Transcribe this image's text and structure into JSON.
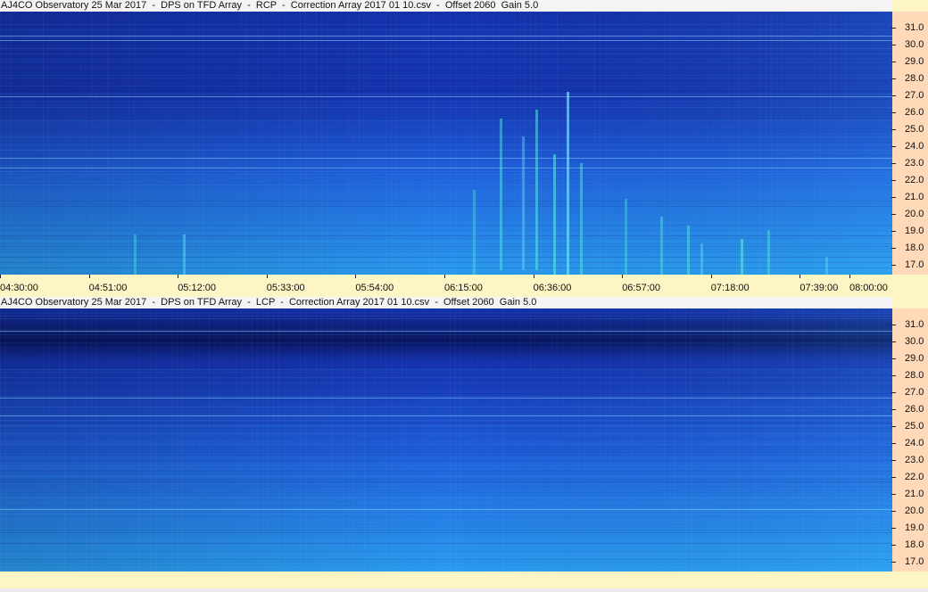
{
  "chart_data": [
    {
      "type": "heatmap",
      "title": "AJ4CO Observatory 25 Mar 2017  -  DPS on TFD Array  -  RCP  -  Correction Array 2017 01 10.csv  -  Offset 2060  Gain 5.0",
      "polarization": "RCP",
      "x_ticks": [
        "04:30:00",
        "04:51:00",
        "05:12:00",
        "05:33:00",
        "05:54:00",
        "06:15:00",
        "06:36:00",
        "06:57:00",
        "07:18:00",
        "07:39:00",
        "08:00:00"
      ],
      "y_ticks": [
        "31.0",
        "30.0",
        "29.0",
        "28.0",
        "27.0",
        "26.0",
        "25.0",
        "24.0",
        "23.0",
        "22.0",
        "21.0",
        "20.0",
        "19.0",
        "18.0",
        "17.0"
      ],
      "colormap": [
        "#0a1560",
        "#1533b0",
        "#1f5fdc",
        "#2a9cf0",
        "#3fd6ee"
      ]
    },
    {
      "type": "heatmap",
      "title": "AJ4CO Observatory 25 Mar 2017  -  DPS on TFD Array  -  LCP  -  Correction Array 2017 01 10.csv  -  Offset 2060  Gain 5.0",
      "polarization": "LCP",
      "y_ticks": [
        "31.0",
        "30.0",
        "29.0",
        "28.0",
        "27.0",
        "26.0",
        "25.0",
        "24.0",
        "23.0",
        "22.0",
        "21.0",
        "20.0",
        "19.0",
        "18.0",
        "17.0"
      ],
      "colormap": [
        "#0a1560",
        "#1533b0",
        "#1f5fdc",
        "#2a9cf0",
        "#3fd6ee"
      ]
    }
  ]
}
